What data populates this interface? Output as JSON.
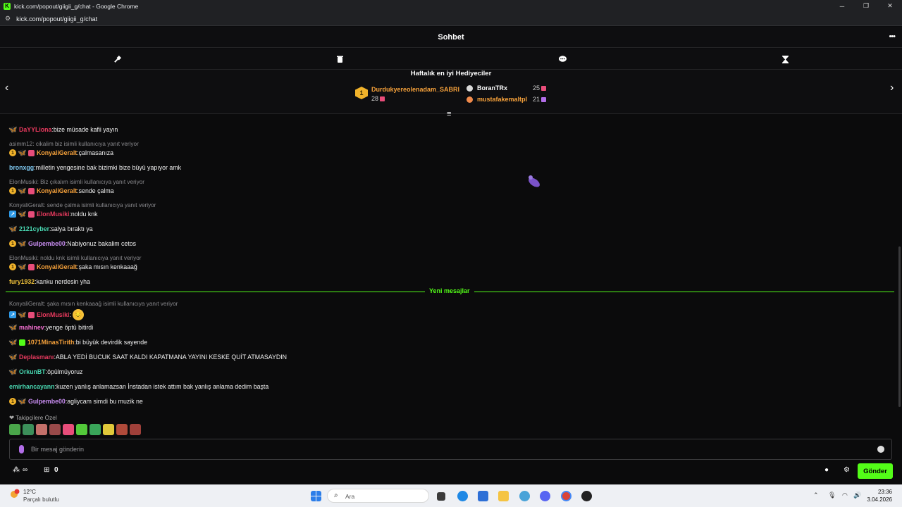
{
  "browser": {
    "window_title": "kick.com/popout/giigii_g/chat - Google Chrome",
    "url": "kick.com/popout/giigii_g/chat",
    "controls": [
      "─",
      "❐",
      "✕"
    ]
  },
  "header": {
    "title": "Sohbet",
    "more": "•••"
  },
  "tools": [
    "hammer-icon",
    "trash-icon",
    "chat-bubble-icon",
    "hourglass-icon"
  ],
  "gifters": {
    "title": "Haftalık en iyi Hediyeciler",
    "top": {
      "rank": "1",
      "name": "Durdukyereolenadam_SABRI",
      "amount": "28"
    },
    "others": [
      {
        "name": "BoranTRx",
        "amount": "25",
        "color": "#ffffff",
        "icon_color": "#d9d9d9"
      },
      {
        "name": "mustafakemaltpl",
        "amount": "21",
        "color": "#f7a23b",
        "icon_color": "#f08a4b"
      }
    ]
  },
  "messages": [
    {
      "user": "DaYYLiona",
      "color": "#e83a5e",
      "text": "bize müsade kafii yayın",
      "badges": [
        "fly"
      ]
    },
    {
      "reply": "asimm12: cikalim biz isimli kullanıcıya yanıt veriyor"
    },
    {
      "user": "KonyaliGeralt",
      "color": "#f7a23b",
      "text": "çalmasanıza",
      "badges": [
        "gold",
        "fly-y",
        "gift"
      ]
    },
    {
      "user": "bronxgg",
      "color": "#7ec8f0",
      "text": "milletin yengesine bak bizimki bize büyü yapıyor amk",
      "badges": []
    },
    {
      "reply": "ElonMusiki: Biz çıkalım isimli kullanıcıya yanıt veriyor"
    },
    {
      "user": "KonyaliGeralt",
      "color": "#f7a23b",
      "text": "sende çalma",
      "badges": [
        "gold",
        "fly-y",
        "gift"
      ]
    },
    {
      "reply": "KonyaliGeralt: sende çalma isimli kullanıcıya yanıt veriyor"
    },
    {
      "user": "ElonMusiki",
      "color": "#e83a5e",
      "text": "noldu knk",
      "badges": [
        "sword",
        "fly-y",
        "gift"
      ]
    },
    {
      "user": "2121cyber",
      "color": "#48d6b0",
      "text": "salya bıraktı ya",
      "badges": [
        "fly"
      ]
    },
    {
      "user": "Gulpembe00",
      "color": "#c78cf0",
      "text": "Nabiyonuz bakalim cetos",
      "badges": [
        "gold",
        "fly"
      ]
    },
    {
      "reply": "ElonMusiki: noldu knk isimli kullanıcıya yanıt veriyor"
    },
    {
      "user": "KonyaliGeralt",
      "color": "#f7a23b",
      "text": "şaka mısın kenkaaağ",
      "badges": [
        "gold",
        "fly-y",
        "gift"
      ]
    },
    {
      "user": "fury1932",
      "color": "#f0c23a",
      "text": "kanku nerdesin yha",
      "badges": []
    }
  ],
  "divider": "Yeni mesajlar",
  "new_messages": [
    {
      "reply": "KonyaliGeralt: şaka mısın kenkaaağ isimli kullanıcıya yanıt veriyor"
    },
    {
      "user": "ElonMusiki",
      "color": "#e83a5e",
      "text": "",
      "badges": [
        "sword",
        "fly-y",
        "gift"
      ],
      "emoji": "😔"
    },
    {
      "user": "mahinev",
      "color": "#f36fd1",
      "text": "yenge öptü bitirdi",
      "badges": [
        "fly"
      ]
    },
    {
      "user": "1071MinasTirith",
      "color": "#f7a23b",
      "text": "bi büyük devirdik sayende",
      "badges": [
        "fly",
        "gift-green"
      ]
    },
    {
      "user": "Deplasmanı",
      "color": "#e83a5e",
      "text": "ABLA YEDİ BUCUK SAAT KALDI KAPATMANA YAYINI KESKE QUİT ATMASAYDIN",
      "badges": [
        "fly"
      ]
    },
    {
      "user": "OrkunBT",
      "color": "#48d6b0",
      "text": "öpülmüyoruz",
      "badges": [
        "fly"
      ]
    },
    {
      "user": "emirhancayann",
      "color": "#48d6b0",
      "text": "kuzen yanlış anlamazsan İnstadan istek attım bak yanlış anlama dedim başta",
      "badges": []
    },
    {
      "user": "Gulpembe00",
      "color": "#c78cf0",
      "text": "agliycam simdi bu muzik ne",
      "badges": [
        "gold",
        "fly"
      ]
    }
  ],
  "emotes_label": "Takipçilere Özel",
  "input": {
    "placeholder": "Bir mesaj gönderin"
  },
  "bottom": {
    "infinity": "∞",
    "count": "0",
    "send": "Gönder"
  },
  "taskbar": {
    "temp": "12°C",
    "condition": "Parçalı bulutlu",
    "search": "Ara",
    "time": "23:36",
    "date": "3.04.2026"
  }
}
